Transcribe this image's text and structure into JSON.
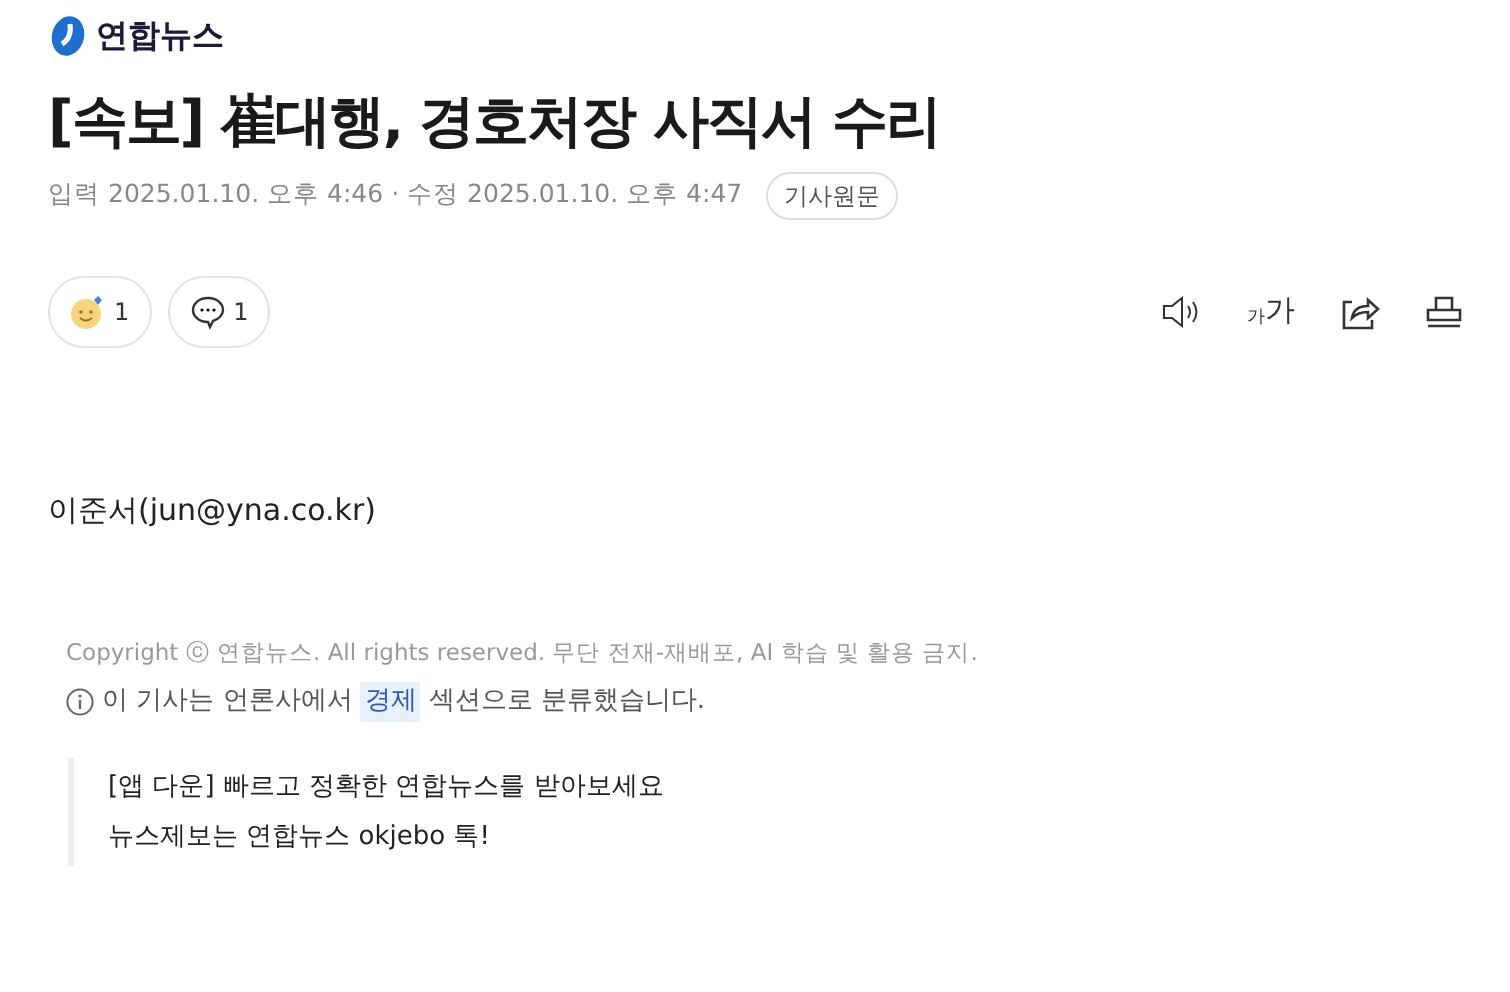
{
  "logo": {
    "text": "연합뉴스"
  },
  "headline": "[속보] 崔대행, 경호처장 사직서 수리",
  "meta": {
    "input_label": "입력",
    "input_time": "2025.01.10. 오후 4:46",
    "separator": "·",
    "edit_label": "수정",
    "edit_time": "2025.01.10. 오후 4:47",
    "original_button": "기사원문"
  },
  "reactions": [
    {
      "kind": "emotion",
      "count": "1"
    },
    {
      "kind": "comment",
      "count": "1"
    }
  ],
  "tools": [
    {
      "kind": "audio"
    },
    {
      "kind": "font"
    },
    {
      "kind": "share"
    },
    {
      "kind": "print"
    }
  ],
  "font_tool_text": {
    "small": "가",
    "large": "가"
  },
  "reporter": "이준서(jun@yna.co.kr)",
  "copyright": "Copyright ⓒ 연합뉴스. All rights reserved. 무단 전재-재배포, AI 학습 및 활용 금지.",
  "section_note": {
    "prefix": "이 기사는 언론사에서",
    "section": "경제",
    "suffix": "섹션으로 분류했습니다."
  },
  "promo": [
    "[앱 다운] 빠르고 정확한 연합뉴스를 받아보세요",
    "뉴스제보는 연합뉴스 okjebo 톡!"
  ]
}
